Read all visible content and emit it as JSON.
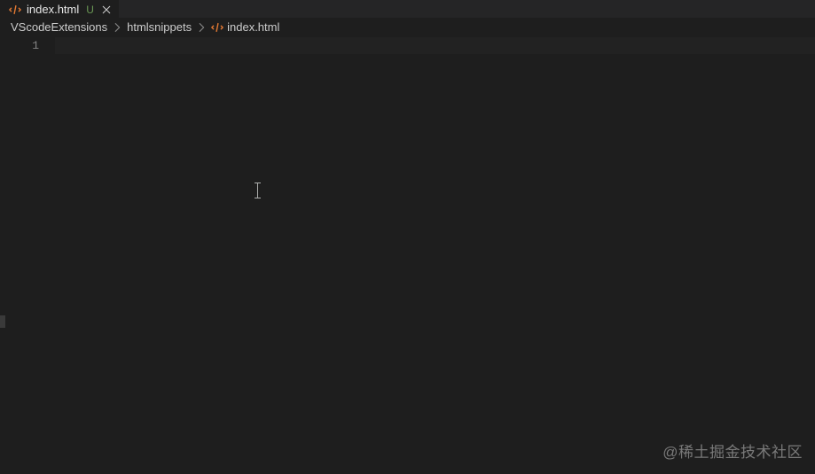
{
  "tab": {
    "filename": "index.html",
    "dirty_indicator": "U",
    "icon": "html-file-icon"
  },
  "breadcrumbs": [
    {
      "label": "VScodeExtensions",
      "icon": null
    },
    {
      "label": "htmlsnippets",
      "icon": null
    },
    {
      "label": "index.html",
      "icon": "html-file-icon"
    }
  ],
  "editor": {
    "line_numbers": [
      "1"
    ],
    "content": ""
  },
  "watermark": "@稀土掘金技术社区",
  "colors": {
    "background": "#1e1e1e",
    "tabbar": "#252526",
    "text": "#cccccc",
    "gutter": "#858585",
    "html_icon": "#e37933"
  }
}
